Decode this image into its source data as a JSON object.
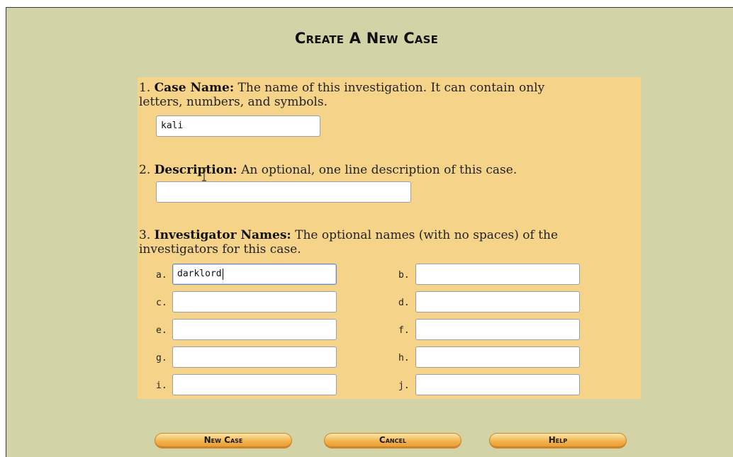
{
  "title": "Create A New Case",
  "case_name": {
    "number": "1.",
    "label": "Case Name:",
    "description_line1": "The name of this investigation. It can contain only",
    "description_line2": "letters, numbers, and symbols.",
    "value": "kali"
  },
  "description": {
    "number": "2.",
    "label": "Description:",
    "description": "An optional, one line description of this case.",
    "value": ""
  },
  "investigators": {
    "number": "3.",
    "label": "Investigator Names:",
    "description_line1": "The optional names (with no spaces) of the",
    "description_line2": "investigators for this case.",
    "fields": [
      {
        "label": "a.",
        "value": "darklord"
      },
      {
        "label": "b.",
        "value": ""
      },
      {
        "label": "c.",
        "value": ""
      },
      {
        "label": "d.",
        "value": ""
      },
      {
        "label": "e.",
        "value": ""
      },
      {
        "label": "f.",
        "value": ""
      },
      {
        "label": "g.",
        "value": ""
      },
      {
        "label": "h.",
        "value": ""
      },
      {
        "label": "i.",
        "value": ""
      },
      {
        "label": "j.",
        "value": ""
      }
    ]
  },
  "buttons": {
    "new_case": "New Case",
    "cancel": "Cancel",
    "help": "Help"
  },
  "colors": {
    "page_background": "#d3d3a8",
    "form_panel": "#f5d48a",
    "button": "#f2b24e"
  }
}
